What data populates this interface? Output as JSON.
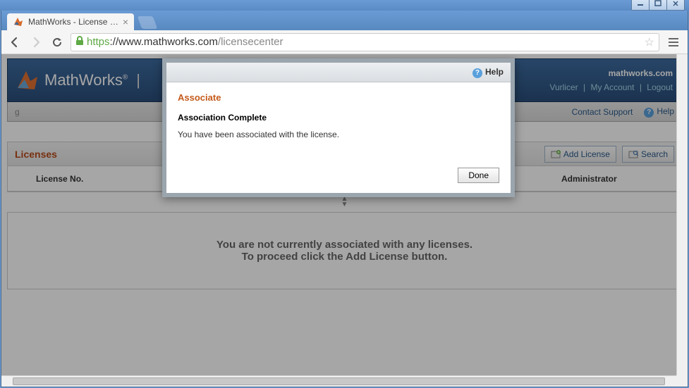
{
  "browser": {
    "tab_title": "MathWorks - License Cent",
    "url_protocol": "https",
    "url_host": "://www.mathworks.com",
    "url_path": "/licensecenter"
  },
  "header": {
    "brand": "MathWorks",
    "domain": "mathworks.com",
    "user": "Vurlicer",
    "my_account": "My Account",
    "logout": "Logout"
  },
  "subbar": {
    "contact": "Contact Support",
    "help": "Help"
  },
  "licenses": {
    "title": "Licenses",
    "add_btn": "Add License",
    "search_btn": "Search",
    "col_license_no": "License No.",
    "col_admin": "Administrator"
  },
  "empty": {
    "line1": "You are not currently associated with any licenses.",
    "line2": "To proceed click the Add License button."
  },
  "modal": {
    "help": "Help",
    "title": "Associate",
    "subtitle": "Association Complete",
    "message": "You have been associated with the license.",
    "done": "Done"
  }
}
